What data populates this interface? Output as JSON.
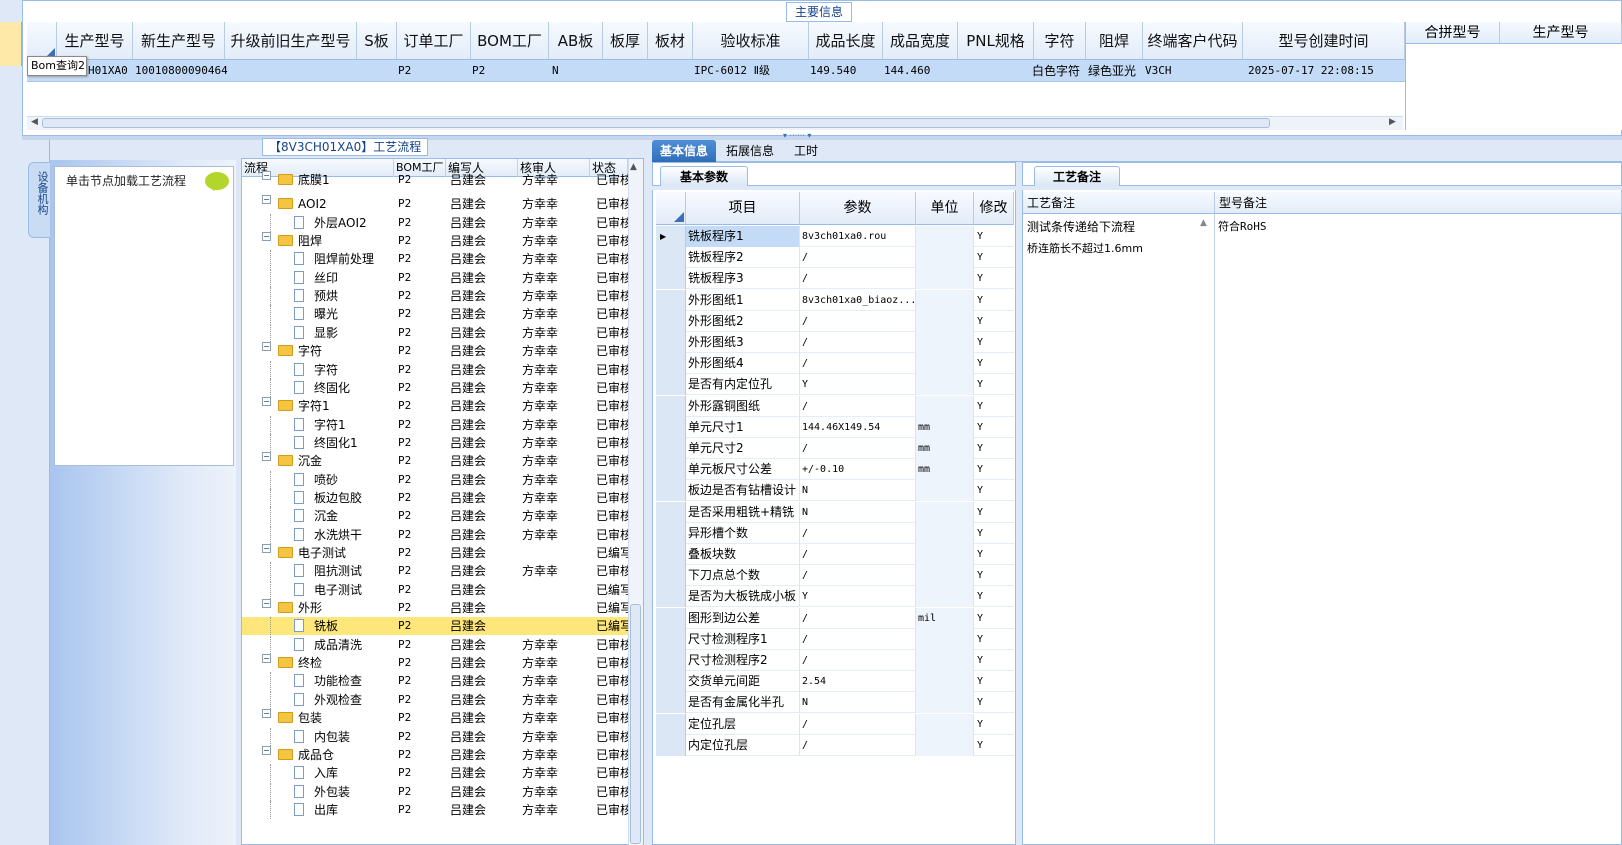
{
  "top": {
    "legend": "主要信息",
    "tooltip": "Bom查询2",
    "headers": [
      "生产型号",
      "新生产型号",
      "升级前旧生产型号",
      "S板",
      "订单工厂",
      "BOM工厂",
      "AB板",
      "板厚",
      "板材",
      "验收标准",
      "成品长度",
      "成品宽度",
      "PNL规格",
      "字符",
      "阻焊",
      "终端客户代码",
      "型号创建时间"
    ],
    "row": {
      "prod_model": "H01XA0",
      "new_model": "10010800090464",
      "order_factory": "P2",
      "bom_factory": "P2",
      "ab_board": "N",
      "standard": "IPC-6012 Ⅱ级",
      "length": "149.540",
      "width": "144.460",
      "char": "白色字符",
      "solder": "绿色亚光",
      "customer_code": "V3CH",
      "created": "2025-07-17 22:08:15"
    },
    "merge_headers": [
      "合拼型号",
      "生产型号"
    ]
  },
  "left": {
    "vtab": "设备机构",
    "hint": "单击节点加载工艺流程"
  },
  "tree": {
    "title": "【8V3CH01XA0】工艺流程",
    "headers": [
      "流程",
      "BOM工厂",
      "编写人",
      "核审人",
      "状态"
    ],
    "rows": [
      {
        "level": 0,
        "type": "folder",
        "name": "底膜1",
        "factory": "P2",
        "writer": "吕建会",
        "reviewer": "方幸幸",
        "status": "已审核"
      },
      {
        "level": 0,
        "type": "folder",
        "name": "AOI2",
        "factory": "P2",
        "writer": "吕建会",
        "reviewer": "方幸幸",
        "status": "已审核"
      },
      {
        "level": 1,
        "type": "doc",
        "name": "外层AOI2",
        "factory": "P2",
        "writer": "吕建会",
        "reviewer": "方幸幸",
        "status": "已审核"
      },
      {
        "level": 0,
        "type": "folder",
        "name": "阻焊",
        "factory": "P2",
        "writer": "吕建会",
        "reviewer": "方幸幸",
        "status": "已审核"
      },
      {
        "level": 1,
        "type": "doc",
        "name": "阻焊前处理",
        "factory": "P2",
        "writer": "吕建会",
        "reviewer": "方幸幸",
        "status": "已审核"
      },
      {
        "level": 1,
        "type": "doc",
        "name": "丝印",
        "factory": "P2",
        "writer": "吕建会",
        "reviewer": "方幸幸",
        "status": "已审核"
      },
      {
        "level": 1,
        "type": "doc",
        "name": "预烘",
        "factory": "P2",
        "writer": "吕建会",
        "reviewer": "方幸幸",
        "status": "已审核"
      },
      {
        "level": 1,
        "type": "doc",
        "name": "曝光",
        "factory": "P2",
        "writer": "吕建会",
        "reviewer": "方幸幸",
        "status": "已审核"
      },
      {
        "level": 1,
        "type": "doc",
        "name": "显影",
        "factory": "P2",
        "writer": "吕建会",
        "reviewer": "方幸幸",
        "status": "已审核"
      },
      {
        "level": 0,
        "type": "folder",
        "name": "字符",
        "factory": "P2",
        "writer": "吕建会",
        "reviewer": "方幸幸",
        "status": "已审核"
      },
      {
        "level": 1,
        "type": "doc",
        "name": "字符",
        "factory": "P2",
        "writer": "吕建会",
        "reviewer": "方幸幸",
        "status": "已审核"
      },
      {
        "level": 1,
        "type": "doc",
        "name": "终固化",
        "factory": "P2",
        "writer": "吕建会",
        "reviewer": "方幸幸",
        "status": "已审核"
      },
      {
        "level": 0,
        "type": "folder",
        "name": "字符1",
        "factory": "P2",
        "writer": "吕建会",
        "reviewer": "方幸幸",
        "status": "已审核"
      },
      {
        "level": 1,
        "type": "doc",
        "name": "字符1",
        "factory": "P2",
        "writer": "吕建会",
        "reviewer": "方幸幸",
        "status": "已审核"
      },
      {
        "level": 1,
        "type": "doc",
        "name": "终固化1",
        "factory": "P2",
        "writer": "吕建会",
        "reviewer": "方幸幸",
        "status": "已审核"
      },
      {
        "level": 0,
        "type": "folder",
        "name": "沉金",
        "factory": "P2",
        "writer": "吕建会",
        "reviewer": "方幸幸",
        "status": "已审核"
      },
      {
        "level": 1,
        "type": "doc",
        "name": "喷砂",
        "factory": "P2",
        "writer": "吕建会",
        "reviewer": "方幸幸",
        "status": "已审核"
      },
      {
        "level": 1,
        "type": "doc",
        "name": "板边包胶",
        "factory": "P2",
        "writer": "吕建会",
        "reviewer": "方幸幸",
        "status": "已审核"
      },
      {
        "level": 1,
        "type": "doc",
        "name": "沉金",
        "factory": "P2",
        "writer": "吕建会",
        "reviewer": "方幸幸",
        "status": "已审核"
      },
      {
        "level": 1,
        "type": "doc",
        "name": "水洗烘干",
        "factory": "P2",
        "writer": "吕建会",
        "reviewer": "方幸幸",
        "status": "已审核"
      },
      {
        "level": 0,
        "type": "folder",
        "name": "电子测试",
        "factory": "P2",
        "writer": "吕建会",
        "reviewer": "",
        "status": "已编写"
      },
      {
        "level": 1,
        "type": "doc",
        "name": "阻抗测试",
        "factory": "P2",
        "writer": "吕建会",
        "reviewer": "方幸幸",
        "status": "已审核"
      },
      {
        "level": 1,
        "type": "doc",
        "name": "电子测试",
        "factory": "P2",
        "writer": "吕建会",
        "reviewer": "",
        "status": "已编写"
      },
      {
        "level": 0,
        "type": "folder",
        "name": "外形",
        "factory": "P2",
        "writer": "吕建会",
        "reviewer": "",
        "status": "已编写"
      },
      {
        "level": 1,
        "type": "doc",
        "name": "铣板",
        "factory": "P2",
        "writer": "吕建会",
        "reviewer": "",
        "status": "已编写",
        "selected": true
      },
      {
        "level": 1,
        "type": "doc",
        "name": "成品清洗",
        "factory": "P2",
        "writer": "吕建会",
        "reviewer": "方幸幸",
        "status": "已审核"
      },
      {
        "level": 0,
        "type": "folder",
        "name": "终检",
        "factory": "P2",
        "writer": "吕建会",
        "reviewer": "方幸幸",
        "status": "已审核"
      },
      {
        "level": 1,
        "type": "doc",
        "name": "功能检查",
        "factory": "P2",
        "writer": "吕建会",
        "reviewer": "方幸幸",
        "status": "已审核"
      },
      {
        "level": 1,
        "type": "doc",
        "name": "外观检查",
        "factory": "P2",
        "writer": "吕建会",
        "reviewer": "方幸幸",
        "status": "已审核"
      },
      {
        "level": 0,
        "type": "folder",
        "name": "包装",
        "factory": "P2",
        "writer": "吕建会",
        "reviewer": "方幸幸",
        "status": "已审核"
      },
      {
        "level": 1,
        "type": "doc",
        "name": "内包装",
        "factory": "P2",
        "writer": "吕建会",
        "reviewer": "方幸幸",
        "status": "已审核"
      },
      {
        "level": 0,
        "type": "folder",
        "name": "成品仓",
        "factory": "P2",
        "writer": "吕建会",
        "reviewer": "方幸幸",
        "status": "已审核"
      },
      {
        "level": 1,
        "type": "doc",
        "name": "入库",
        "factory": "P2",
        "writer": "吕建会",
        "reviewer": "方幸幸",
        "status": "已审核"
      },
      {
        "level": 1,
        "type": "doc",
        "name": "外包装",
        "factory": "P2",
        "writer": "吕建会",
        "reviewer": "方幸幸",
        "status": "已审核"
      },
      {
        "level": 1,
        "type": "doc",
        "name": "出库",
        "factory": "P2",
        "writer": "吕建会",
        "reviewer": "方幸幸",
        "status": "已审核"
      }
    ]
  },
  "tabs": [
    "基本信息",
    "拓展信息",
    "工时"
  ],
  "basic": {
    "subtab": "基本参数",
    "headers": [
      "项目",
      "参数",
      "单位",
      "修改"
    ],
    "rows": [
      {
        "item": "铣板程序1",
        "param": "8v3ch01xa0.rou",
        "unit": "",
        "mod": "Y",
        "selected": true
      },
      {
        "item": "铣板程序2",
        "param": "/",
        "unit": "",
        "mod": "Y"
      },
      {
        "item": "铣板程序3",
        "param": "/",
        "unit": "",
        "mod": "Y"
      },
      {
        "item": "外形图纸1",
        "param": "8v3ch01xa0_biaoz...",
        "unit": "",
        "mod": "Y"
      },
      {
        "item": "外形图纸2",
        "param": "/",
        "unit": "",
        "mod": "Y"
      },
      {
        "item": "外形图纸3",
        "param": "/",
        "unit": "",
        "mod": "Y"
      },
      {
        "item": "外形图纸4",
        "param": "/",
        "unit": "",
        "mod": "Y"
      },
      {
        "item": "是否有内定位孔",
        "param": "Y",
        "unit": "",
        "mod": "Y"
      },
      {
        "item": "外形露铜图纸",
        "param": "/",
        "unit": "",
        "mod": "Y"
      },
      {
        "item": "单元尺寸1",
        "param": "144.46X149.54",
        "unit": "mm",
        "mod": "Y"
      },
      {
        "item": "单元尺寸2",
        "param": "/",
        "unit": "mm",
        "mod": "Y"
      },
      {
        "item": "单元板尺寸公差",
        "param": "+/-0.10",
        "unit": "mm",
        "mod": "Y"
      },
      {
        "item": "板边是否有钻槽设计",
        "param": "N",
        "unit": "",
        "mod": "Y"
      },
      {
        "item": "是否采用粗铣+精铣",
        "param": "N",
        "unit": "",
        "mod": "Y"
      },
      {
        "item": "异形槽个数",
        "param": "/",
        "unit": "",
        "mod": "Y"
      },
      {
        "item": "叠板块数",
        "param": "/",
        "unit": "",
        "mod": "Y"
      },
      {
        "item": "下刀点总个数",
        "param": "/",
        "unit": "",
        "mod": "Y"
      },
      {
        "item": "是否为大板铣成小板",
        "param": "Y",
        "unit": "",
        "mod": "Y"
      },
      {
        "item": "图形到边公差",
        "param": "/",
        "unit": "mil",
        "mod": "Y"
      },
      {
        "item": "尺寸检测程序1",
        "param": "/",
        "unit": "",
        "mod": "Y"
      },
      {
        "item": "尺寸检测程序2",
        "param": "/",
        "unit": "",
        "mod": "Y"
      },
      {
        "item": "交货单元间距",
        "param": "2.54",
        "unit": "",
        "mod": "Y"
      },
      {
        "item": "是否有金属化半孔",
        "param": "N",
        "unit": "",
        "mod": "Y"
      },
      {
        "item": "定位孔层",
        "param": "/",
        "unit": "",
        "mod": "Y"
      },
      {
        "item": "内定位孔层",
        "param": "/",
        "unit": "",
        "mod": "Y"
      }
    ]
  },
  "remark": {
    "tab": "工艺备注",
    "headers": [
      "工艺备注",
      "型号备注"
    ],
    "process_notes": [
      "测试条传递给下流程",
      "桥连筋长不超过1.6mm"
    ],
    "model_note": "符合RoHS"
  }
}
